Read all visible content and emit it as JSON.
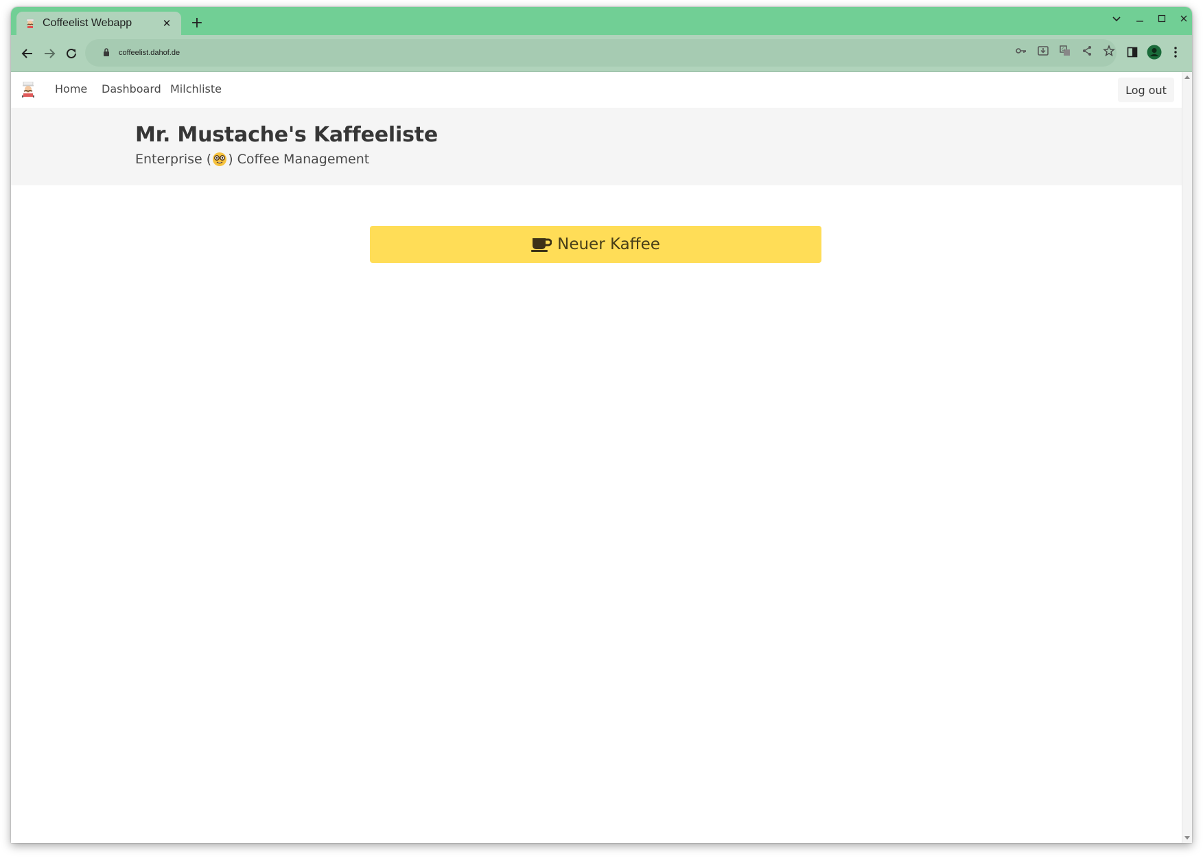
{
  "browser": {
    "tab_title": "Coffeelist Webapp",
    "new_tab_symbol": "+",
    "close_symbol": "✕",
    "url": "coffeelist.dahof.de",
    "accent_color": "#71cf95",
    "toolbar_color": "#b0d3bb",
    "window_controls": {
      "tab_search": "⌄",
      "minimize": "—",
      "maximize": "◻",
      "close": "✕"
    },
    "toolbar_icons": [
      "back-icon",
      "forward-icon",
      "reload-icon",
      "lock-icon",
      "key-icon",
      "install-icon",
      "translate-icon",
      "share-icon",
      "star-icon",
      "side-panel-icon",
      "profile-icon",
      "menu-icon"
    ]
  },
  "navbar": {
    "links": {
      "home": "Home",
      "dashboard": "Dashboard",
      "milk": "Milchliste"
    },
    "logout_label": "Log out"
  },
  "hero": {
    "title": "Mr. Mustache's Kaffeeliste",
    "subtitle_before": "Enterprise (",
    "subtitle_after": ") Coffee Management"
  },
  "main": {
    "new_coffee_label": "Neuer Kaffee",
    "button_color": "#ffdd57"
  }
}
